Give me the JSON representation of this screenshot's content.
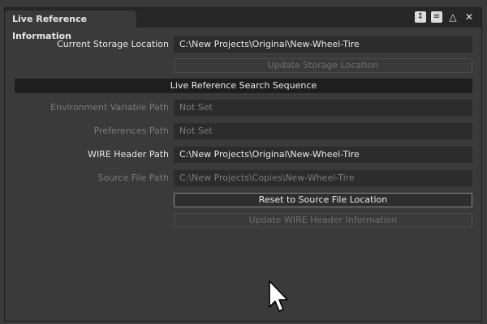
{
  "panel": {
    "tab_title": "Live Reference Information",
    "titlebar_icons": [
      "sort-icon",
      "menu-icon",
      "triangle-icon",
      "close-icon"
    ],
    "titlebar_glyphs": {
      "sort": "↕",
      "menu": "≡",
      "triangle": "△",
      "close": "✕"
    }
  },
  "storage": {
    "label": "Current Storage Location",
    "value": "C:\\New Projects\\Original\\New-Wheel-Tire",
    "update_button": "Update Storage Location"
  },
  "search_sequence": {
    "header": "Live Reference Search Sequence",
    "env_var": {
      "label": "Environment Variable Path",
      "value": "Not Set"
    },
    "preferences": {
      "label": "Preferences Path",
      "value": "Not Set"
    },
    "wire_header": {
      "label": "WIRE Header Path",
      "value": "C:\\New Projects\\Original\\New-Wheel-Tire"
    },
    "source_file": {
      "label": "Source File Path",
      "value": "C:\\New Projects\\Copies\\New-Wheel-Tire"
    }
  },
  "actions": {
    "reset_button": "Reset to Source File Location",
    "update_wire_button": "Update WIRE Header Information"
  }
}
